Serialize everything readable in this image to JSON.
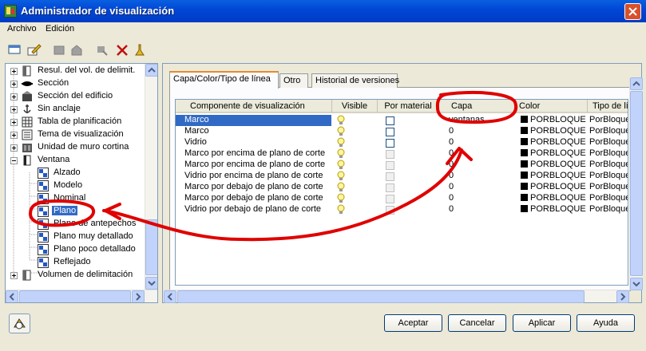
{
  "window": {
    "title": "Administrador de visualización"
  },
  "menu": [
    "Archivo",
    "Edición"
  ],
  "toolbar": {
    "icons": [
      "new-icon",
      "edit-icon",
      "copy-icon",
      "paste-icon",
      "purge-icon",
      "delete-icon",
      "clean-icon"
    ]
  },
  "tree": {
    "items": [
      {
        "label": "Resul. del vol. de delimit.",
        "level": 0,
        "expander": "plus",
        "icon": "box-icon"
      },
      {
        "label": "Sección",
        "level": 0,
        "expander": "plus",
        "icon": "section-icon"
      },
      {
        "label": "Sección del edificio",
        "level": 0,
        "expander": "plus",
        "icon": "building-section-icon"
      },
      {
        "label": "Sin anclaje",
        "level": 0,
        "expander": "plus",
        "icon": "anchor-icon"
      },
      {
        "label": "Tabla de planificación",
        "level": 0,
        "expander": "plus",
        "icon": "table-icon"
      },
      {
        "label": "Tema de visualización",
        "level": 0,
        "expander": "plus",
        "icon": "theme-icon"
      },
      {
        "label": "Unidad de muro cortina",
        "level": 0,
        "expander": "plus",
        "icon": "curtain-wall-icon"
      },
      {
        "label": "Ventana",
        "level": 0,
        "expander": "minus",
        "icon": "window-icon"
      },
      {
        "label": "Alzado",
        "level": 1,
        "icon": "display-rep-icon"
      },
      {
        "label": "Modelo",
        "level": 1,
        "icon": "display-rep-icon"
      },
      {
        "label": "Nominal",
        "level": 1,
        "icon": "display-rep-icon"
      },
      {
        "label": "Plano",
        "level": 1,
        "icon": "display-rep-icon",
        "selected": true
      },
      {
        "label": "Plano de antepechos",
        "level": 1,
        "icon": "display-rep-icon"
      },
      {
        "label": "Plano muy detallado",
        "level": 1,
        "icon": "display-rep-icon"
      },
      {
        "label": "Plano poco detallado",
        "level": 1,
        "icon": "display-rep-icon"
      },
      {
        "label": "Reflejado",
        "level": 1,
        "icon": "display-rep-icon"
      },
      {
        "label": "Volumen de delimitación",
        "level": 0,
        "expander": "plus",
        "icon": "box-icon"
      }
    ]
  },
  "tabs": [
    {
      "label": "Capa/Color/Tipo de línea",
      "active": true
    },
    {
      "label": "Otro"
    },
    {
      "label": "Historial de versiones"
    }
  ],
  "grid": {
    "columns": [
      "Componente de visualización",
      "Visible",
      "Por material",
      "Capa",
      "Color",
      "Tipo de lín"
    ],
    "rows": [
      {
        "component": "Marco",
        "visible": true,
        "por_material": false,
        "capa": "ventanas",
        "color": "PORBLOQUE",
        "tipo": "PorBloque",
        "selected": true,
        "enabled": true
      },
      {
        "component": "Marco",
        "visible": true,
        "por_material": false,
        "capa": "0",
        "color": "PORBLOQUE",
        "tipo": "PorBloque",
        "enabled": true
      },
      {
        "component": "Vidrio",
        "visible": true,
        "por_material": false,
        "capa": "0",
        "color": "PORBLOQUE",
        "tipo": "PorBloque",
        "enabled": true
      },
      {
        "component": "Marco por encima de plano de corte",
        "visible": true,
        "por_material": false,
        "capa": "0",
        "color": "PORBLOQUE",
        "tipo": "PorBloque",
        "enabled": false
      },
      {
        "component": "Marco por encima de plano de corte",
        "visible": true,
        "por_material": false,
        "capa": "0",
        "color": "PORBLOQUE",
        "tipo": "PorBloque",
        "enabled": false
      },
      {
        "component": "Vidrio por encima de plano de corte",
        "visible": true,
        "por_material": false,
        "capa": "0",
        "color": "PORBLOQUE",
        "tipo": "PorBloque",
        "enabled": false
      },
      {
        "component": "Marco por debajo de plano de corte",
        "visible": true,
        "por_material": false,
        "capa": "0",
        "color": "PORBLOQUE",
        "tipo": "PorBloque",
        "enabled": false
      },
      {
        "component": "Marco por debajo de plano de corte",
        "visible": true,
        "por_material": false,
        "capa": "0",
        "color": "PORBLOQUE",
        "tipo": "PorBloque",
        "enabled": false
      },
      {
        "component": "Vidrio por debajo de plano de corte",
        "visible": true,
        "por_material": false,
        "capa": "0",
        "color": "PORBLOQUE",
        "tipo": "PorBloque",
        "enabled": false
      }
    ]
  },
  "buttons": {
    "accept": "Aceptar",
    "cancel": "Cancelar",
    "apply": "Aplicar",
    "help": "Ayuda"
  },
  "colors": {
    "title_bar": "#0046d5",
    "selection": "#316ac5",
    "annotation": "#e00000",
    "dialog_bg": "#ece9d8"
  }
}
